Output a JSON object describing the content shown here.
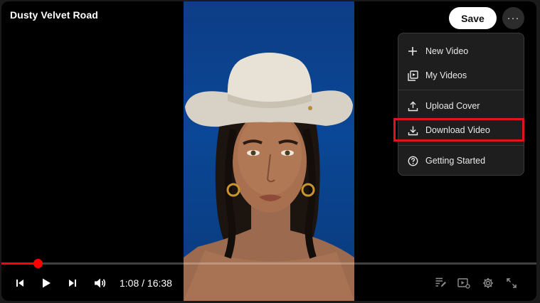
{
  "video": {
    "title": "Dusty Velvet Road"
  },
  "header": {
    "save_label": "Save",
    "more_label": "···"
  },
  "menu": {
    "items": [
      {
        "label": "New Video",
        "icon": "plus-icon"
      },
      {
        "label": "My Videos",
        "icon": "video-library-icon"
      },
      {
        "label": "Upload Cover",
        "icon": "upload-icon"
      },
      {
        "label": "Download Video",
        "icon": "download-icon",
        "highlighted": true
      },
      {
        "label": "Getting Started",
        "icon": "help-circle-icon"
      }
    ]
  },
  "player": {
    "current_time": "1:08",
    "duration": "16:38",
    "time_display": "1:08 / 16:38",
    "progress_fraction": 0.068,
    "playing": false
  },
  "colors": {
    "accent": "#ff0000",
    "highlight_box": "#e0141e",
    "background_blue": "#0a4796"
  }
}
